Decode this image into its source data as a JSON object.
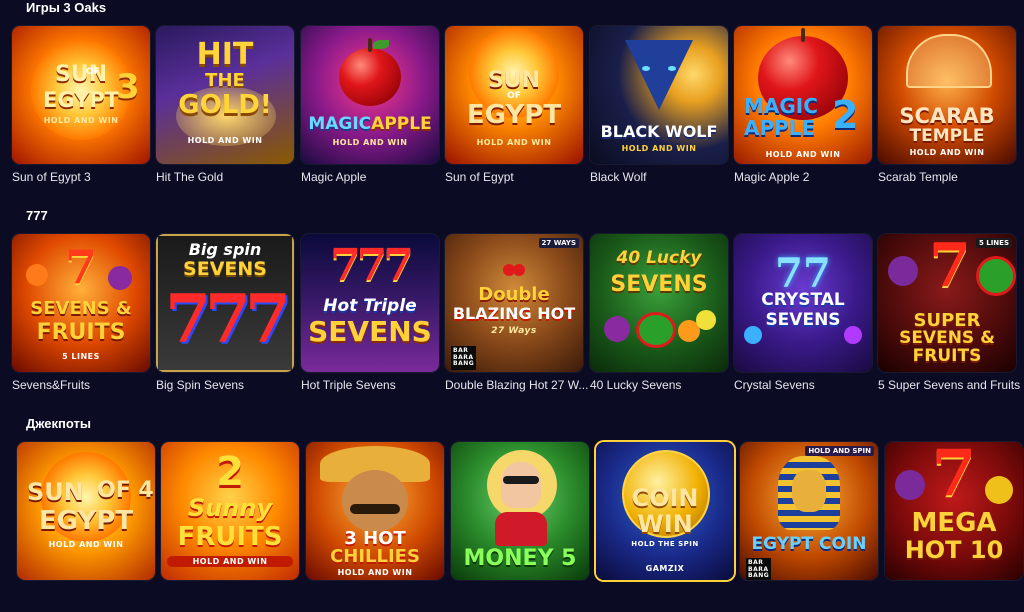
{
  "sections": [
    {
      "title": "Игры 3 Oaks",
      "games": [
        {
          "name": "Sun of Egypt 3",
          "logo_lines": [
            "SUN",
            "OF",
            "EGYPT",
            "3"
          ],
          "sub": "HOLD AND WIN"
        },
        {
          "name": "Hit The Gold",
          "logo_lines": [
            "HIT",
            "THE",
            "GOLD!"
          ],
          "sub": "HOLD AND WIN"
        },
        {
          "name": "Magic Apple",
          "logo_lines": [
            "MAGIC",
            "APPLE"
          ],
          "sub": "HOLD AND WIN"
        },
        {
          "name": "Sun of Egypt",
          "logo_lines": [
            "SUN",
            "OF",
            "EGYPT"
          ],
          "sub": "HOLD AND WIN"
        },
        {
          "name": "Black Wolf",
          "logo_lines": [
            "BLACK WOLF"
          ],
          "sub": "HOLD AND WIN"
        },
        {
          "name": "Magic Apple 2",
          "logo_lines": [
            "MAGIC",
            "APPLE",
            "2"
          ],
          "sub": "HOLD AND WIN"
        },
        {
          "name": "Scarab Temple",
          "logo_lines": [
            "SCARAB",
            "TEMPLE"
          ],
          "sub": "HOLD AND WIN"
        }
      ]
    },
    {
      "title": "777",
      "games": [
        {
          "name": "Sevens&Fruits",
          "logo_lines": [
            "SEVENS &",
            "FRUITS"
          ],
          "sub": "5 LINES"
        },
        {
          "name": "Big Spin Sevens",
          "logo_lines": [
            "Big spin",
            "SEVENS"
          ],
          "sub": ""
        },
        {
          "name": "Hot Triple Sevens",
          "logo_lines": [
            "Hot Triple",
            "SEVENS"
          ],
          "sub": ""
        },
        {
          "name": "Double Blazing Hot 27 W...",
          "logo_lines": [
            "Double",
            "BLAZING HOT"
          ],
          "sub": "27 Ways",
          "badge": "27 WAYS"
        },
        {
          "name": "40 Lucky Sevens",
          "logo_lines": [
            "40 Lucky",
            "SEVENS"
          ],
          "sub": ""
        },
        {
          "name": "Crystal Sevens",
          "logo_lines": [
            "CRYSTAL",
            "SEVENS"
          ],
          "sub": ""
        },
        {
          "name": "5 Super Sevens and Fruits",
          "logo_lines": [
            "SUPER",
            "SEVENS &",
            "FRUITS"
          ],
          "sub": "",
          "badge": "5 LINES"
        }
      ]
    },
    {
      "title": "Джекпоты",
      "games": [
        {
          "name": "",
          "logo_lines": [
            "SUN",
            "OF 4",
            "EGYPT"
          ],
          "sub": "HOLD AND WIN"
        },
        {
          "name": "",
          "logo_lines": [
            "2",
            "Sunny",
            "FRUITS"
          ],
          "sub": "HOLD AND WIN"
        },
        {
          "name": "",
          "logo_lines": [
            "3 HOT",
            "CHILLIES"
          ],
          "sub": "HOLD AND WIN"
        },
        {
          "name": "",
          "logo_lines": [
            "MONEY 5"
          ],
          "sub": ""
        },
        {
          "name": "",
          "logo_lines": [
            "COIN",
            "WIN"
          ],
          "sub": "HOLD THE SPIN",
          "provider": "GAMZIX"
        },
        {
          "name": "",
          "logo_lines": [
            "EGYPT COIN"
          ],
          "sub": "",
          "badge": "HOLD AND SPIN"
        },
        {
          "name": "",
          "logo_lines": [
            "MEGA",
            "HOT 10"
          ],
          "sub": ""
        }
      ]
    }
  ],
  "colors": {
    "background": "#0b0c24",
    "caption": "#e6e6ee"
  }
}
